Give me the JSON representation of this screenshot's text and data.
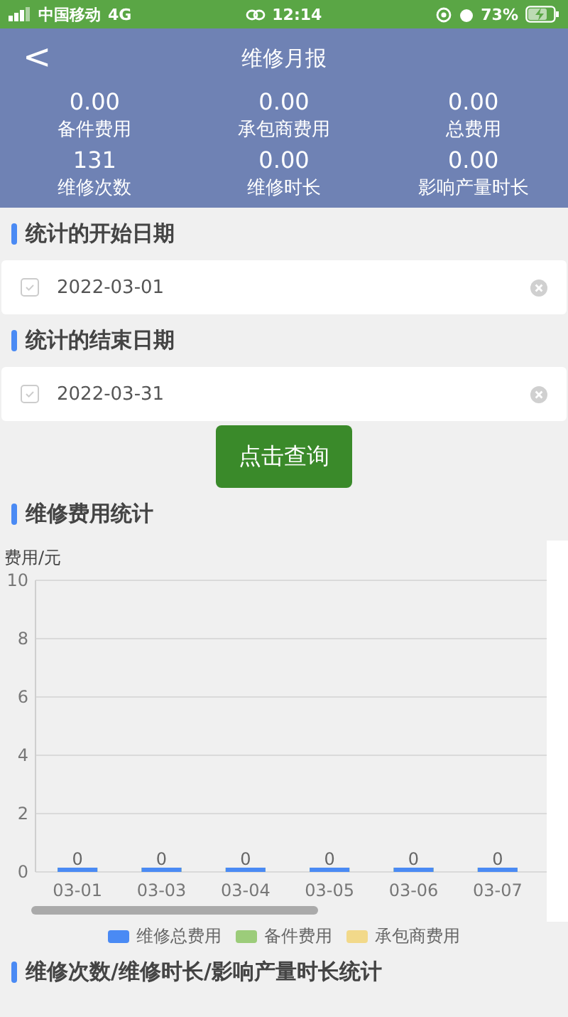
{
  "status_bar": {
    "carrier": "中国移动",
    "network": "4G",
    "time": "12:14",
    "battery": "73%"
  },
  "header": {
    "title": "维修月报",
    "back": "<"
  },
  "stats": [
    {
      "value": "0.00",
      "label": "备件费用"
    },
    {
      "value": "0.00",
      "label": "承包商费用"
    },
    {
      "value": "0.00",
      "label": "总费用"
    },
    {
      "value": "131",
      "label": "维修次数"
    },
    {
      "value": "0.00",
      "label": "维修时长"
    },
    {
      "value": "0.00",
      "label": "影响产量时长"
    }
  ],
  "start": {
    "heading": "统计的开始日期",
    "value": "2022-03-01"
  },
  "end": {
    "heading": "统计的结束日期",
    "value": "2022-03-31"
  },
  "query_button": "点击查询",
  "cost_section": {
    "heading": "维修费用统计",
    "chart_data": {
      "type": "bar",
      "ylabel": "费用/元",
      "categories": [
        "03-01",
        "03-03",
        "03-04",
        "03-05",
        "03-06",
        "03-07"
      ],
      "ylim": [
        0,
        10
      ],
      "yticks": [
        0,
        2,
        4,
        6,
        8,
        10
      ],
      "stacked": true,
      "grid": true,
      "value_labels": [
        [
          "0",
          "0",
          "0",
          "0",
          "0",
          "0"
        ],
        [
          null,
          null,
          null,
          null,
          null,
          null
        ],
        [
          null,
          null,
          null,
          null,
          null,
          null
        ]
      ],
      "series": [
        {
          "name": "维修总费用",
          "color": "#4a8af4",
          "values": [
            0,
            0,
            0,
            0,
            0,
            0
          ]
        },
        {
          "name": "备件费用",
          "color": "#9ccc7a",
          "values": [
            0,
            0,
            0,
            0,
            0,
            0
          ]
        },
        {
          "name": "承包商费用",
          "color": "#f2d98a",
          "values": [
            0,
            0,
            0,
            0,
            0,
            0
          ]
        }
      ]
    }
  },
  "next_heading": "维修次数/维修时长/影响产量时长统计"
}
